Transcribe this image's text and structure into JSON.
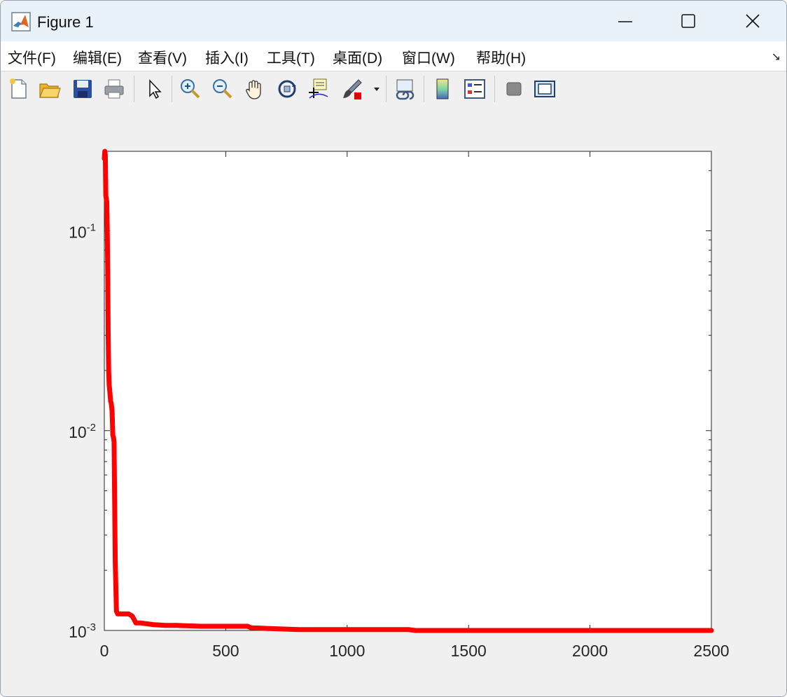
{
  "window": {
    "title": "Figure 1",
    "controls": [
      "minimize",
      "maximize",
      "close"
    ]
  },
  "menu": {
    "items": [
      "文件(F)",
      "编辑(E)",
      "查看(V)",
      "插入(I)",
      "工具(T)",
      "桌面(D)",
      "窗口(W)",
      "帮助(H)"
    ],
    "corner_icon": "undock-arrow-icon"
  },
  "toolbar": {
    "buttons": [
      "new-figure-icon",
      "open-file-icon",
      "save-icon",
      "print-icon",
      "edit-plot-arrow-icon",
      "zoom-in-icon",
      "zoom-out-icon",
      "pan-hand-icon",
      "rotate-3d-icon",
      "data-cursor-icon",
      "brush-icon",
      "link-plot-icon",
      "colorbar-icon",
      "legend-icon",
      "hide-plot-tools-icon",
      "show-plot-tools-icon"
    ]
  },
  "chart_data": {
    "type": "line",
    "title": "",
    "xlabel": "",
    "ylabel": "",
    "xlim": [
      0,
      2500
    ],
    "ylim": [
      0.001,
      0.25
    ],
    "yscale": "log",
    "xticks": [
      "0",
      "500",
      "1000",
      "1500",
      "2000",
      "2500"
    ],
    "yticks": [
      {
        "value": 0.001,
        "base": "10",
        "exp": "-3"
      },
      {
        "value": 0.01,
        "base": "10",
        "exp": "-2"
      },
      {
        "value": 0.1,
        "base": "10",
        "exp": "-1"
      }
    ],
    "grid": false,
    "legend": "none",
    "series": [
      {
        "color": "#ff0000",
        "x": [
          0,
          2,
          4,
          6,
          8,
          10,
          12,
          14,
          16,
          18,
          20,
          22,
          24,
          26,
          28,
          30,
          32,
          35,
          38,
          40,
          42,
          45,
          50,
          55,
          60,
          80,
          100,
          115,
          130,
          150,
          200,
          250,
          300,
          400,
          500,
          590,
          605,
          700,
          800,
          1000,
          1200,
          1255,
          1280,
          1500,
          2000,
          2500
        ],
        "y": [
          0.23,
          0.25,
          0.24,
          0.15,
          0.145,
          0.14,
          0.1,
          0.06,
          0.03,
          0.02,
          0.017,
          0.016,
          0.015,
          0.014,
          0.0138,
          0.0132,
          0.0125,
          0.0095,
          0.0092,
          0.0088,
          0.005,
          0.0022,
          0.00125,
          0.00121,
          0.00121,
          0.00121,
          0.00121,
          0.00118,
          0.00109,
          0.00109,
          0.00107,
          0.00106,
          0.00106,
          0.00105,
          0.00105,
          0.00105,
          0.00103,
          0.00102,
          0.00101,
          0.00101,
          0.00101,
          0.00101,
          0.001,
          0.001,
          0.001,
          0.001
        ]
      }
    ]
  }
}
